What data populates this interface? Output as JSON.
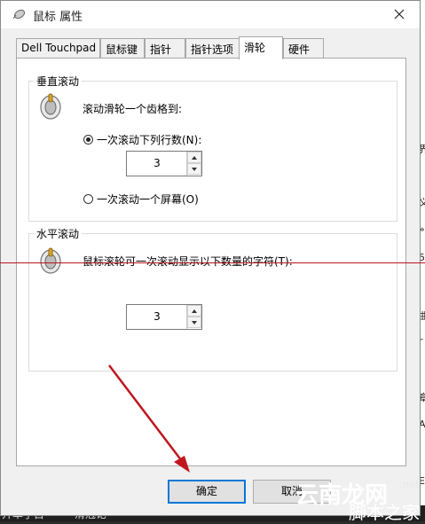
{
  "dialog": {
    "title": "鼠标 属性"
  },
  "tabs": [
    {
      "label": "Dell Touchpad",
      "active": false
    },
    {
      "label": "鼠标键",
      "active": false
    },
    {
      "label": "指针",
      "active": false
    },
    {
      "label": "指针选项",
      "active": false
    },
    {
      "label": "滑轮",
      "active": true
    },
    {
      "label": "硬件",
      "active": false
    }
  ],
  "vertical_scroll": {
    "group_label": "垂直滚动",
    "description": "滚动滑轮一个齿格到:",
    "option_lines_label": "一次滚动下列行数(N):",
    "option_lines_selected": true,
    "lines_value": "3",
    "option_screen_label": "一次滚动一个屏幕(O)",
    "option_screen_selected": false
  },
  "horizontal_scroll": {
    "group_label": "水平滚动",
    "description": "鼠标滚轮可一次滚动显示以下数量的字符(T):",
    "chars_value": "3"
  },
  "buttons": {
    "ok": "确定",
    "cancel": "取消"
  },
  "background": {
    "left_letter": "书",
    "right_chars": [
      "界",
      "义",
      "»",
      "5",
      "曲",
      "r",
      "章",
      "A",
      "E"
    ],
    "taskbar_text": [
      "开单子目",
      "滑冠论"
    ]
  },
  "watermark": {
    "main": "云南龙网",
    "domain": ".net",
    "sub": "脚本之家"
  },
  "colors": {
    "annotation_red": "#b8141b",
    "accent_blue": "#0078d7"
  }
}
